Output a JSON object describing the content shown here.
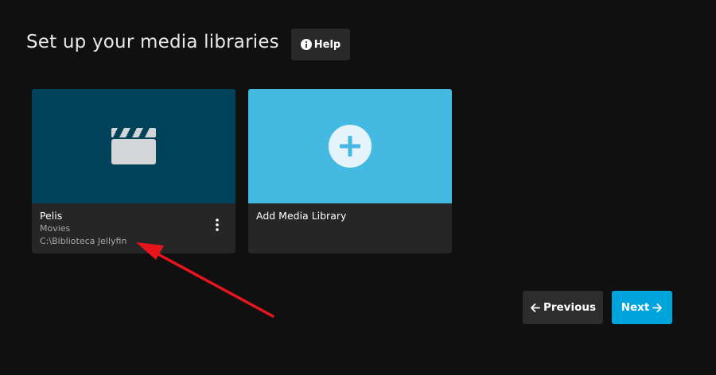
{
  "header": {
    "title": "Set up your media libraries",
    "help_label": "Help",
    "help_icon": "info-icon"
  },
  "libraries": [
    {
      "name": "Pelis",
      "type": "Movies",
      "path": "C:\\Biblioteca Jellyfin",
      "icon": "clapperboard-icon",
      "image_color": "#00435a"
    }
  ],
  "add_library": {
    "label": "Add Media Library",
    "icon": "plus-circle-icon",
    "image_color": "#44b9e2"
  },
  "navigation": {
    "previous_label": "Previous",
    "next_label": "Next"
  },
  "colors": {
    "background": "#101010",
    "accent": "#00a4dc",
    "annotation": "#e8151c"
  }
}
